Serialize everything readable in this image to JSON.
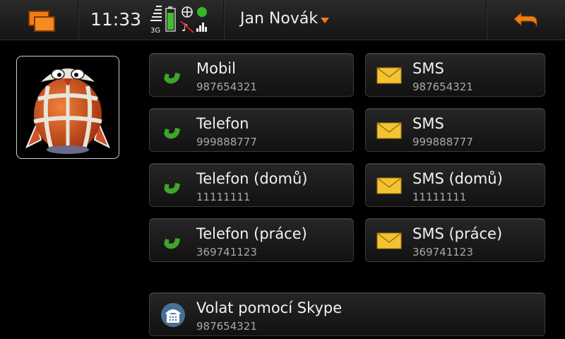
{
  "status_bar": {
    "time": "11:33",
    "network_type": "3G"
  },
  "header": {
    "contact_name": "Jan Novák"
  },
  "icons": {
    "task_switcher": "task-switcher-icon",
    "back": "back-arrow-icon",
    "call": "phone-handset-icon",
    "sms": "envelope-icon",
    "skype": "skype-phone-icon"
  },
  "colors": {
    "accent": "#f07d16",
    "call_green": "#3fa52a",
    "sms_yellow": "#f2c433"
  },
  "actions": {
    "call": [
      {
        "label": "Mobil",
        "number": "987654321"
      },
      {
        "label": "Telefon",
        "number": "999888777"
      },
      {
        "label": "Telefon (domů)",
        "number": "11111111"
      },
      {
        "label": "Telefon (práce)",
        "number": "369741123"
      }
    ],
    "sms": [
      {
        "label": "SMS",
        "number": "987654321"
      },
      {
        "label": "SMS",
        "number": "999888777"
      },
      {
        "label": "SMS (domů)",
        "number": "11111111"
      },
      {
        "label": "SMS (práce)",
        "number": "369741123"
      }
    ],
    "skype": {
      "label": "Volat pomocí Skype",
      "number": "987654321"
    }
  }
}
